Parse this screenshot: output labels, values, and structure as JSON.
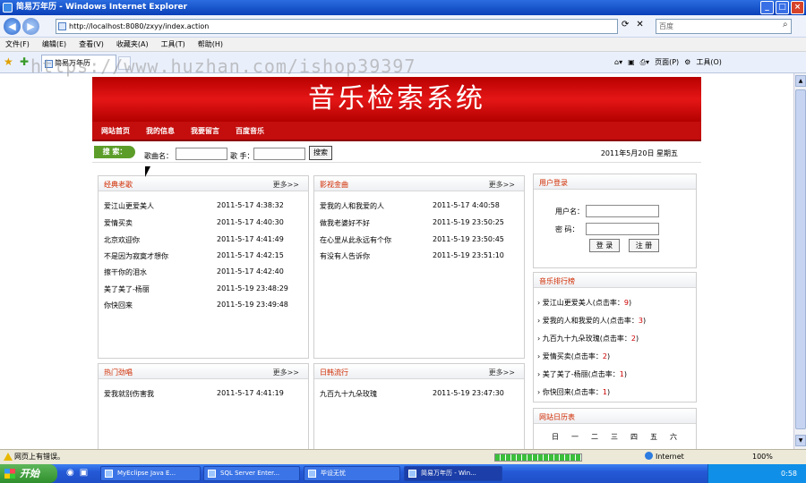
{
  "window": {
    "title": "简易万年历 - Windows Internet Explorer"
  },
  "address": {
    "url": "http://localhost:8080/zxyy/index.action",
    "search_placeholder": "百度"
  },
  "menu": [
    "文件(F)",
    "编辑(E)",
    "查看(V)",
    "收藏夹(A)",
    "工具(T)",
    "帮助(H)"
  ],
  "tab": {
    "label": "简易万年历"
  },
  "ie_tools": {
    "page": "页面(P)",
    "tools": "工具(O)"
  },
  "watermark": "https://www.huzhan.com/ishop39397",
  "site": {
    "banner": "音乐检索系统",
    "nav": [
      "网站首页",
      "我的信息",
      "我要留言",
      "百度音乐"
    ],
    "search": {
      "badge": "搜 索：",
      "song_label": "歌曲名：",
      "singer_label": "歌 手：",
      "button": "搜索"
    },
    "date": "2011年5月20日 星期五"
  },
  "panels": {
    "classic": {
      "title": "经典老歌",
      "more": "更多>>",
      "items": [
        {
          "t": "爱江山更爱美人",
          "d": "2011-5-17 4:38:32"
        },
        {
          "t": "爱情买卖",
          "d": "2011-5-17 4:40:30"
        },
        {
          "t": "北京欢迎你",
          "d": "2011-5-17 4:41:49"
        },
        {
          "t": "不是因为寂寞才想你",
          "d": "2011-5-17 4:42:15"
        },
        {
          "t": "擦干你的泪水",
          "d": "2011-5-17 4:42:40"
        },
        {
          "t": "美了美了-杨丽",
          "d": "2011-5-19 23:48:29"
        },
        {
          "t": "你快回来",
          "d": "2011-5-19 23:49:48"
        }
      ]
    },
    "film": {
      "title": "影视金曲",
      "more": "更多>>",
      "items": [
        {
          "t": "爱我的人和我爱的人",
          "d": "2011-5-17 4:40:58"
        },
        {
          "t": "做我老婆好不好",
          "d": "2011-5-19 23:50:25"
        },
        {
          "t": "在心里从此永远有个你",
          "d": "2011-5-19 23:50:45"
        },
        {
          "t": "有没有人告诉你",
          "d": "2011-5-19 23:51:10"
        }
      ]
    },
    "hot": {
      "title": "热门劲唱",
      "more": "更多>>",
      "items": [
        {
          "t": "爱我就别伤害我",
          "d": "2011-5-17 4:41:19"
        }
      ]
    },
    "korean": {
      "title": "日韩流行",
      "more": "更多>>",
      "items": [
        {
          "t": "九百九十九朵玫瑰",
          "d": "2011-5-19 23:47:30"
        }
      ]
    },
    "login": {
      "title": "用户登录",
      "username": "用户名：",
      "password": "密 码：",
      "login_btn": "登 录",
      "register_btn": "注 册"
    },
    "ranking": {
      "title": "音乐排行榜",
      "items": [
        {
          "t": "爱江山更爱美人(点击率：",
          "c": "9",
          "e": ")"
        },
        {
          "t": "爱我的人和我爱的人(点击率：",
          "c": "3",
          "e": ")"
        },
        {
          "t": "九百九十九朵玫瑰(点击率：",
          "c": "2",
          "e": ")"
        },
        {
          "t": "爱情买卖(点击率：",
          "c": "2",
          "e": ")"
        },
        {
          "t": "美了美了-杨丽(点击率：",
          "c": "1",
          "e": ")"
        },
        {
          "t": "你快回来(点击率：",
          "c": "1",
          "e": ")"
        }
      ]
    },
    "calendar": {
      "title": "网站日历表",
      "weekdays": [
        "日",
        "一",
        "二",
        "三",
        "四",
        "五",
        "六"
      ]
    }
  },
  "status": {
    "message": "网页上有错误。",
    "zone": "Internet",
    "zoom": "100%"
  },
  "taskbar": {
    "start": "开始",
    "buttons": [
      "MyEclipse Java E...",
      "SQL Server Enter...",
      "毕设无忧",
      "简易万年历 - Win..."
    ],
    "clock": "0:58"
  }
}
